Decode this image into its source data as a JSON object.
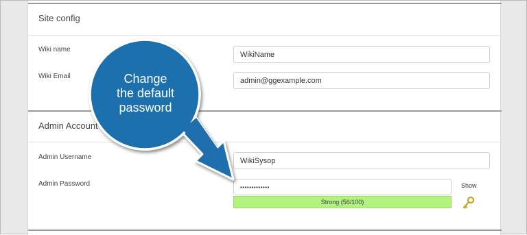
{
  "site_config": {
    "title": "Site config",
    "wiki_name": {
      "label": "Wiki name",
      "value": "WikiName"
    },
    "wiki_email": {
      "label": "Wiki Email",
      "value": "admin@ggexample.com"
    }
  },
  "admin_account": {
    "title": "Admin Account",
    "username": {
      "label": "Admin Username",
      "value": "WikiSysop"
    },
    "password": {
      "label": "Admin Password",
      "value": "•••••••••••••",
      "show_label": "Show",
      "strength": "Strong (56/100)"
    }
  },
  "callout": {
    "line1": "Change",
    "line2": "the default",
    "line3": "password"
  },
  "colors": {
    "callout_fill": "#1f6fae",
    "meter_fill": "#b2f27e"
  },
  "icons": {
    "generate_password": "key-icon"
  }
}
